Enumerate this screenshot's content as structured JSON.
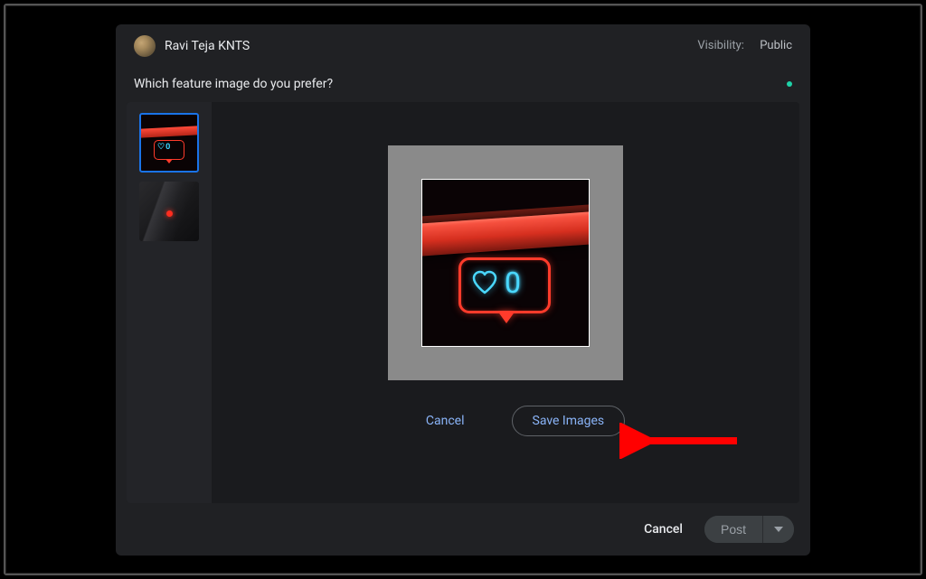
{
  "header": {
    "user_name": "Ravi Teja KNTS",
    "visibility_label": "Visibility:",
    "visibility_value": "Public"
  },
  "question": "Which feature image do you prefer?",
  "neon": {
    "zero": "0"
  },
  "inner_actions": {
    "cancel": "Cancel",
    "save": "Save Images"
  },
  "footer": {
    "cancel": "Cancel",
    "post": "Post"
  }
}
